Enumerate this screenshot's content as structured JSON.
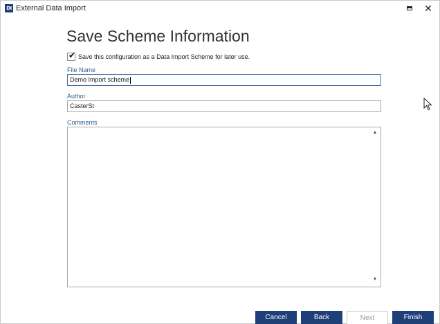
{
  "window": {
    "icon_text": "DI",
    "title": "External Data Import",
    "maximize_glyph": "■",
    "close_glyph": "✕"
  },
  "page": {
    "title": "Save Scheme Information"
  },
  "save_checkbox": {
    "checked": true,
    "check_glyph": "✔",
    "label": "Save this configuration as a Data Import Scheme for later use."
  },
  "fields": {
    "file_name": {
      "label": "File Name",
      "value": "Demo Import scheme"
    },
    "author": {
      "label": "Author",
      "value": "CasterSt"
    },
    "comments": {
      "label": "Comments",
      "value": ""
    }
  },
  "scroll": {
    "up_glyph": "▲",
    "down_glyph": "▼"
  },
  "buttons": {
    "cancel": "Cancel",
    "back": "Back",
    "next": "Next",
    "finish": "Finish"
  },
  "colors": {
    "accent": "#1f3f79",
    "label": "#2e5f8e"
  }
}
